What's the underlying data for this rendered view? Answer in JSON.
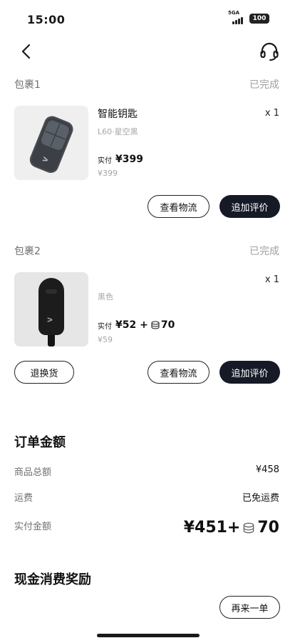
{
  "status_bar": {
    "time": "15:00",
    "network": "5GA",
    "battery": "100"
  },
  "packages": [
    {
      "label": "包裹1",
      "status": "已完成",
      "product": {
        "name": "智能钥匙",
        "variant": "L60·星空黑",
        "quantity": "x 1",
        "paid_prefix": "实付",
        "paid": "¥399",
        "coins": "",
        "original": "¥399"
      },
      "buttons": {
        "logistics": "查看物流",
        "review": "追加评价"
      }
    },
    {
      "label": "包裹2",
      "status": "已完成",
      "product": {
        "name": "",
        "variant": "黑色",
        "quantity": "x 1",
        "paid_prefix": "实付",
        "paid": "¥52 +",
        "coins": "70",
        "original": "¥59"
      },
      "buttons": {
        "return": "退换货",
        "logistics": "查看物流",
        "review": "追加评价"
      }
    }
  ],
  "order_amount": {
    "title": "订单金额",
    "goods_total_label": "商品总额",
    "goods_total_value": "¥458",
    "shipping_label": "运费",
    "shipping_value": "已免运费",
    "paid_label": "实付金额",
    "paid_value": "¥451+",
    "paid_coins": "70"
  },
  "reward": {
    "title": "现金消费奖励"
  },
  "reorder_button": "再来一单",
  "icons": {
    "back": "back-icon",
    "support": "headset-icon",
    "coin": "coin-icon"
  }
}
